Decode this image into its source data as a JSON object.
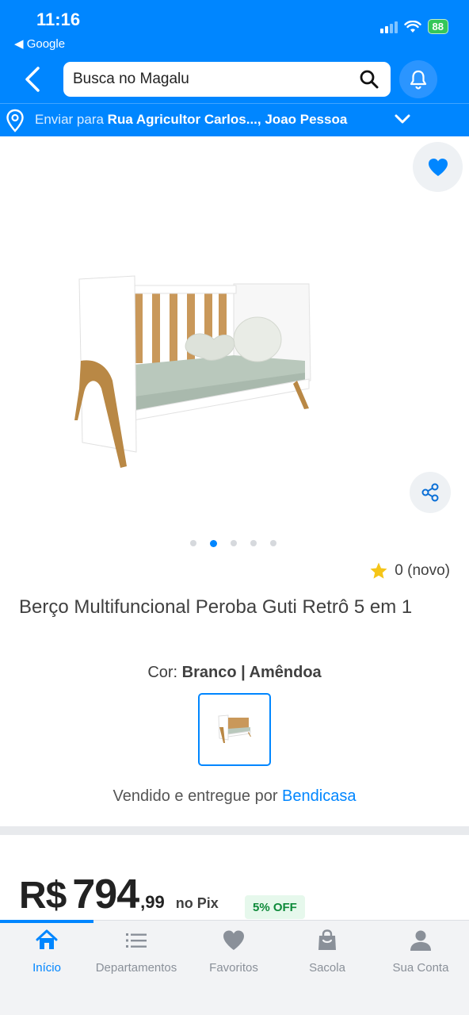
{
  "status_bar": {
    "time": "11:16",
    "back_app": "◀ Google",
    "battery": "88"
  },
  "header": {
    "search_placeholder": "Busca no Magalu",
    "address_prefix": "Enviar para",
    "address_value": "Rua Agricultor Carlos..., Joao Pessoa"
  },
  "product": {
    "title": "Berço Multifuncional Peroba Guti Retrô 5 em 1",
    "rating_text": "0 (novo)",
    "color_label": "Cor:",
    "color_value": "Branco | Amêndoa",
    "seller_prefix": "Vendido e entregue por",
    "seller_name": "Bendicasa",
    "carousel": {
      "total": 5,
      "active_index": 1
    }
  },
  "price": {
    "currency": "R$",
    "integer": "794",
    "decimal": ",99",
    "method": "no Pix",
    "discount": "5% OFF"
  },
  "bottom_nav": [
    {
      "label": "Início",
      "icon": "home-icon",
      "active": true
    },
    {
      "label": "Departamentos",
      "icon": "list-icon",
      "active": false
    },
    {
      "label": "Favoritos",
      "icon": "heart-icon",
      "active": false
    },
    {
      "label": "Sacola",
      "icon": "bag-icon",
      "active": false
    },
    {
      "label": "Sua Conta",
      "icon": "user-icon",
      "active": false
    }
  ],
  "colors": {
    "brand_blue": "#0086ff",
    "star_yellow": "#f5c518",
    "discount_green": "#0e8a3a"
  }
}
